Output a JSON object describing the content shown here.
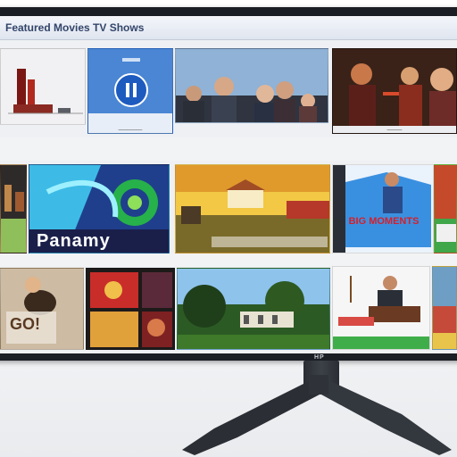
{
  "app": {
    "title": "Featured Movies TV Shows"
  },
  "rows": [
    {
      "tiles": [
        {
          "name": "tile-landmark"
        },
        {
          "name": "tile-app-icon",
          "caption": "________"
        },
        {
          "name": "tile-group-photo"
        },
        {
          "name": "tile-concert",
          "caption": "_____"
        }
      ]
    },
    {
      "tiles": [
        {
          "name": "tile-cityscape"
        },
        {
          "name": "tile-channel",
          "title_art": "Panamy"
        },
        {
          "name": "tile-mansion"
        },
        {
          "name": "tile-poster",
          "title_art": "BIG MOMENTS"
        },
        {
          "name": "tile-edge-strip"
        }
      ]
    },
    {
      "tiles": [
        {
          "name": "tile-bird-show",
          "title_art": "GO!"
        },
        {
          "name": "tile-collage"
        },
        {
          "name": "tile-trees"
        },
        {
          "name": "tile-cooking"
        },
        {
          "name": "tile-edge-right"
        }
      ]
    }
  ],
  "monitor": {
    "brand": "HP"
  },
  "colors": {
    "bezel": "#1b1e24",
    "screen_bg": "#eef0f3",
    "accent": "#2b6fd6"
  }
}
